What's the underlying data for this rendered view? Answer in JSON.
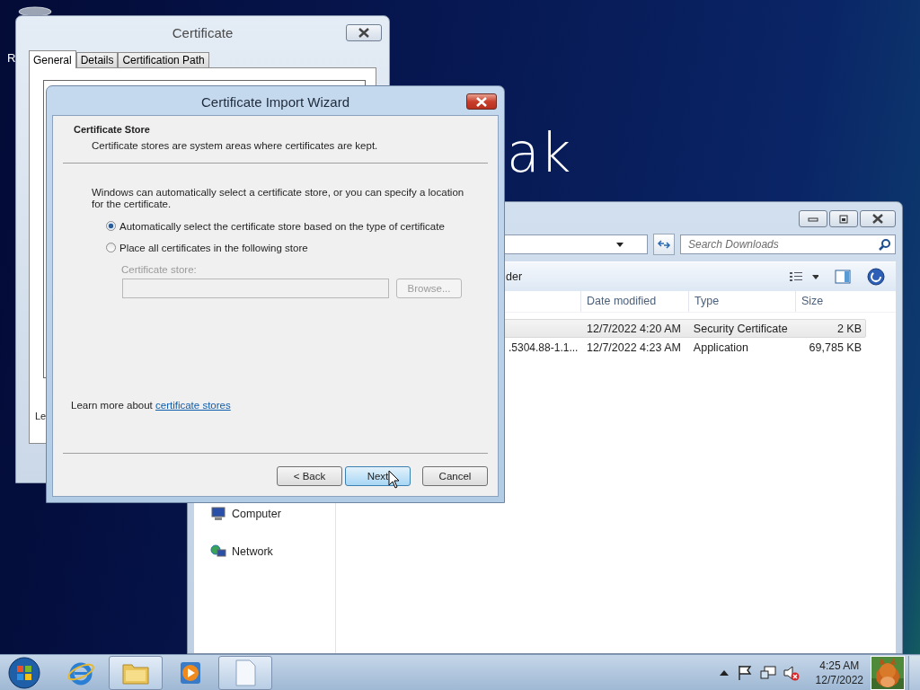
{
  "desktop": {
    "left_text": "R",
    "big_text": "ak"
  },
  "certificate_window": {
    "title": "Certificate",
    "tabs": [
      {
        "label": "General",
        "selected": true
      },
      {
        "label": "Details",
        "selected": false
      },
      {
        "label": "Certification Path",
        "selected": false
      }
    ],
    "cut_text": "Le"
  },
  "wizard": {
    "title": "Certificate Import Wizard",
    "heading": "Certificate Store",
    "subheading": "Certificate stores are system areas where certificates are kept.",
    "intro": "Windows can automatically select a certificate store, or you can specify a location for the certificate.",
    "options": [
      {
        "label": "Automatically select the certificate store based on the type of certificate",
        "selected": true
      },
      {
        "label": "Place all certificates in the following store",
        "selected": false
      }
    ],
    "store_label": "Certificate store:",
    "browse_button": "Browse...",
    "learn_more": "Learn more about",
    "learn_more_link": "certificate stores",
    "buttons": [
      {
        "label": "< Back",
        "kind": "normal"
      },
      {
        "label": "Next",
        "kind": "default"
      },
      {
        "label": "Cancel",
        "kind": "normal"
      }
    ]
  },
  "explorer": {
    "search_placeholder": "Search Downloads",
    "toolbar_text": "der",
    "columns": [
      "Date modified",
      "Type",
      "Size"
    ],
    "rows": [
      {
        "date": "12/7/2022 4:20 AM",
        "type": "Security Certificate",
        "size": "2 KB",
        "selected": true
      },
      {
        "name": ".5304.88-1.1...",
        "date": "12/7/2022 4:23 AM",
        "type": "Application",
        "size": "69,785 KB",
        "selected": false
      }
    ],
    "nav": [
      {
        "label": "Computer",
        "kind": "computer"
      },
      {
        "label": "Network",
        "kind": "network"
      }
    ]
  },
  "taskbar": {
    "apps": [
      {
        "kind": "browser",
        "active": false
      },
      {
        "kind": "folder",
        "active": true
      },
      {
        "kind": "media",
        "active": false
      },
      {
        "kind": "document",
        "active": true
      }
    ],
    "time": "4:25 AM",
    "date": "12/7/2022"
  }
}
